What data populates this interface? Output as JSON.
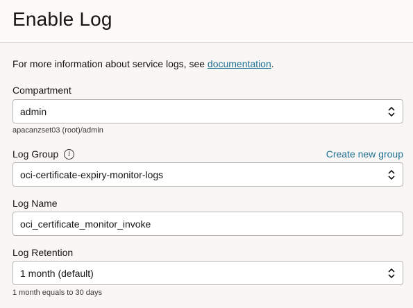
{
  "page": {
    "title": "Enable Log",
    "info_prefix": "For more information about service logs, see ",
    "info_link": "documentation",
    "info_suffix": "."
  },
  "compartment": {
    "label": "Compartment",
    "value": "admin",
    "hint": "apacanzset03 (root)/admin"
  },
  "log_group": {
    "label": "Log Group",
    "create_link": "Create new group",
    "value": "oci-certificate-expiry-monitor-logs",
    "info_icon": "i"
  },
  "log_name": {
    "label": "Log Name",
    "value": "oci_certificate_monitor_invoke"
  },
  "log_retention": {
    "label": "Log Retention",
    "value": "1 month (default)",
    "hint": "1 month equals to 30 days"
  },
  "colors": {
    "link": "#1e6f91",
    "border": "#b8b5b0",
    "background": "#f8f7f5"
  }
}
